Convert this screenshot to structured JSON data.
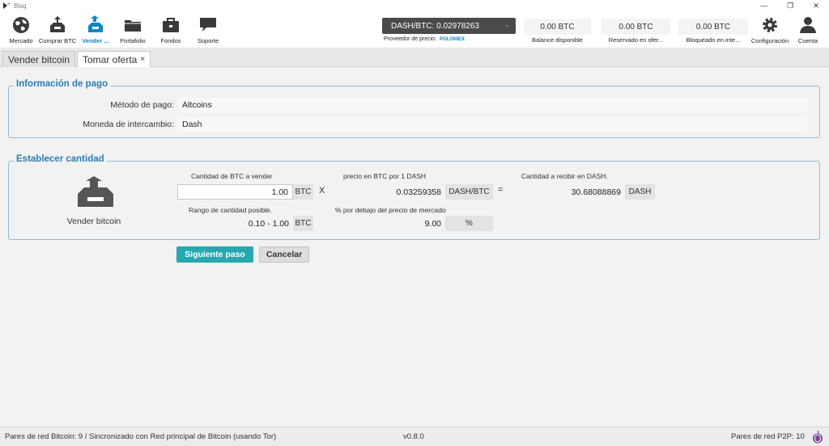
{
  "window": {
    "title": "Bisq",
    "controls": [
      "—",
      "❐",
      "✕"
    ]
  },
  "toolbar": {
    "nav": [
      {
        "label": "Mercado",
        "icon": "globe-icon"
      },
      {
        "label": "Comprar BTC",
        "icon": "buy-btc-icon"
      },
      {
        "label": "Vender ...",
        "icon": "sell-btc-icon"
      },
      {
        "label": "Portafolio",
        "icon": "folder-icon"
      },
      {
        "label": "Fondos",
        "icon": "briefcase-icon"
      },
      {
        "label": "Soporte",
        "icon": "chat-icon"
      }
    ],
    "right_nav": [
      {
        "label": "Configuración",
        "icon": "gear-icon"
      },
      {
        "label": "Cuenta",
        "icon": "user-icon"
      }
    ],
    "price": {
      "value": "DASH/BTC: 0.02978263",
      "provider_label": "Proveedor de precio:",
      "provider": "POLONIEX"
    },
    "balances": [
      {
        "value": "0.00 BTC",
        "label": "Balance disponible"
      },
      {
        "value": "0.00 BTC",
        "label": "Reservado en ofer..."
      },
      {
        "value": "0.00 BTC",
        "label": "Bloqueado en inte..."
      }
    ]
  },
  "tabs": [
    {
      "label": "Vender bitcoin"
    },
    {
      "label": "Tomar oferta",
      "close": "×"
    }
  ],
  "payment": {
    "title": "Información de pago",
    "method_label": "Método de pago:",
    "method_value": "Altcoins",
    "currency_label": "Moneda de intercambio:",
    "currency_value": "Dash"
  },
  "amount": {
    "title": "Establecer cantidad",
    "side_label": "Vender bitcoin",
    "btc_amount_caption": "Cantidad de BTC a vender",
    "btc_amount_value": "1.00",
    "btc_unit": "BTC",
    "times": "X",
    "price_caption": "precio en BTC por 1 DASH",
    "price_value": "0.03259358",
    "price_unit": "DASH/BTC",
    "equals": "=",
    "receive_caption": "Cantidad a recibir en DASH.",
    "receive_value": "30.68088869",
    "receive_unit": "DASH",
    "range_caption": "Rango de cantidad posible.",
    "range_value": "0.10 - 1.00",
    "range_unit": "BTC",
    "pct_caption": "% por debajo del precio de mercado",
    "pct_value": "9.00",
    "pct_unit": "%"
  },
  "buttons": {
    "next": "Siguiente paso",
    "cancel": "Cancelar"
  },
  "status": {
    "left": "Pares de red Bitcoin: 9 / Sincronizado con Red principal de Bitcoin (usando Tor)",
    "version": "v0.8.0",
    "right": "Pares de red P2P: 10"
  },
  "colors": {
    "accent": "#0f87c3",
    "primary_button": "#27a7b0",
    "group_title": "#2b7db4",
    "price_box": "#4a4a4a"
  }
}
